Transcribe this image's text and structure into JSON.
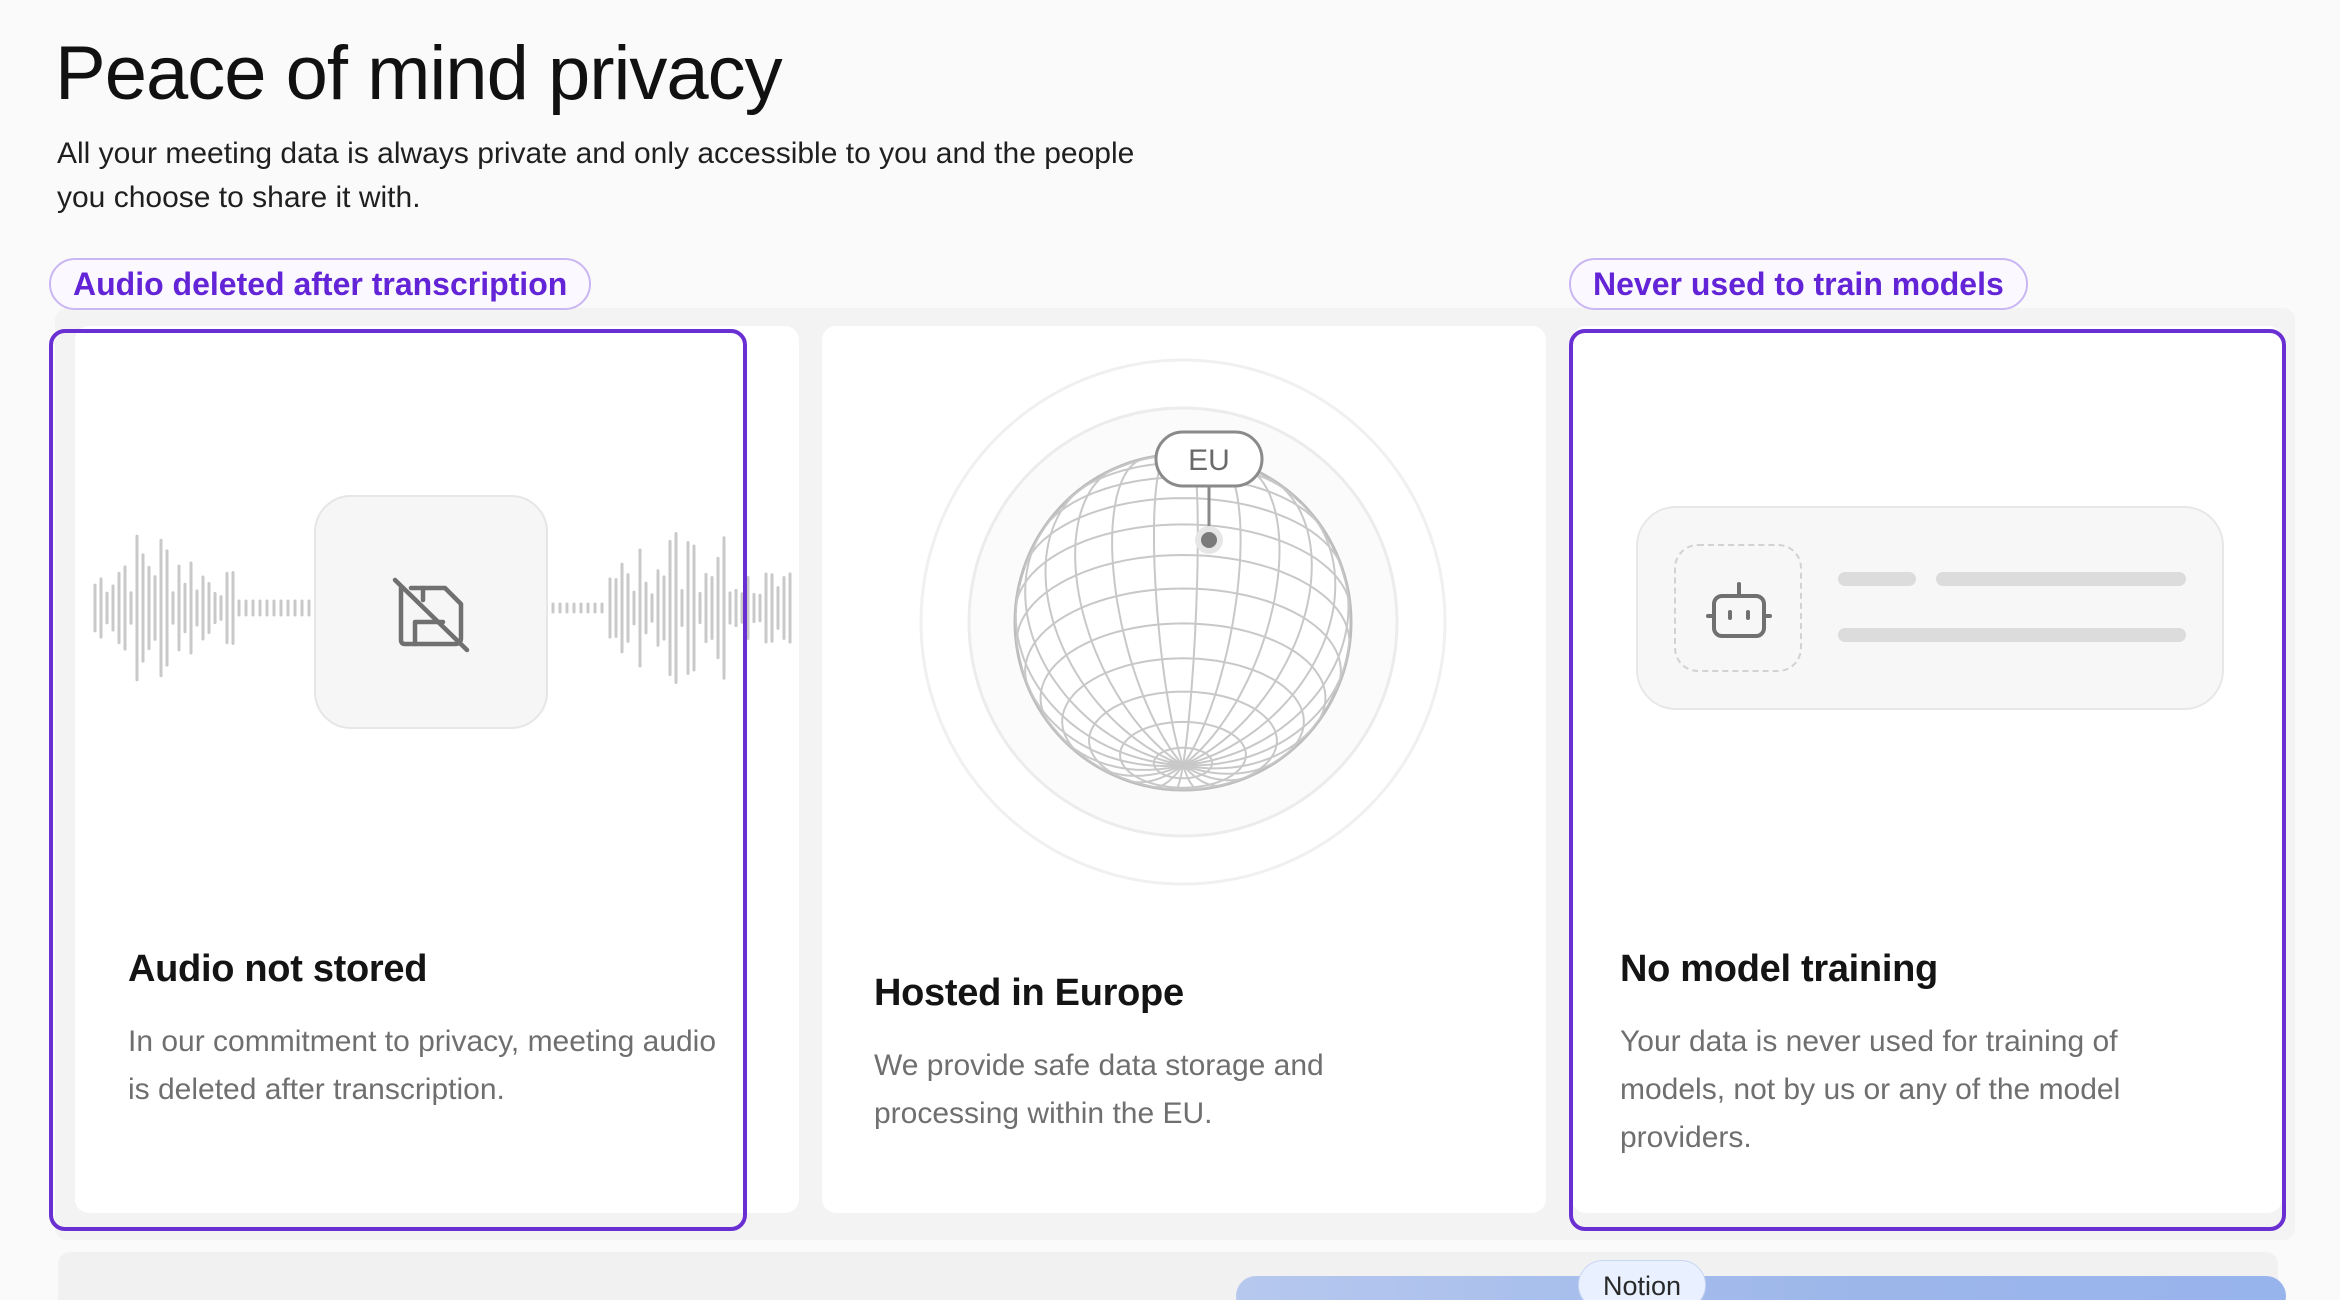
{
  "header": {
    "title": "Peace of mind privacy",
    "subtitle": "All your meeting data is always private and only accessible to you and the people you choose to share it with."
  },
  "badges": {
    "audio": "Audio deleted after transcription",
    "training": "Never used to train models"
  },
  "cards": {
    "audio": {
      "title": "Audio not stored",
      "description": "In our commitment to privacy, meeting audio is deleted after transcription.",
      "icon": "no-save-icon"
    },
    "europe": {
      "title": "Hosted in Europe",
      "description": "We provide safe data storage and processing within the EU.",
      "globe_label": "EU",
      "icon": "globe-icon"
    },
    "training": {
      "title": "No model training",
      "description": "Your data is never used for training of models, not by us or any of the model providers.",
      "icon": "robot-icon"
    }
  },
  "footer": {
    "chip": "Notion"
  },
  "colors": {
    "accent": "#6a2fd3",
    "badge_text": "#6224d6",
    "muted_text": "#6f6f6f"
  }
}
